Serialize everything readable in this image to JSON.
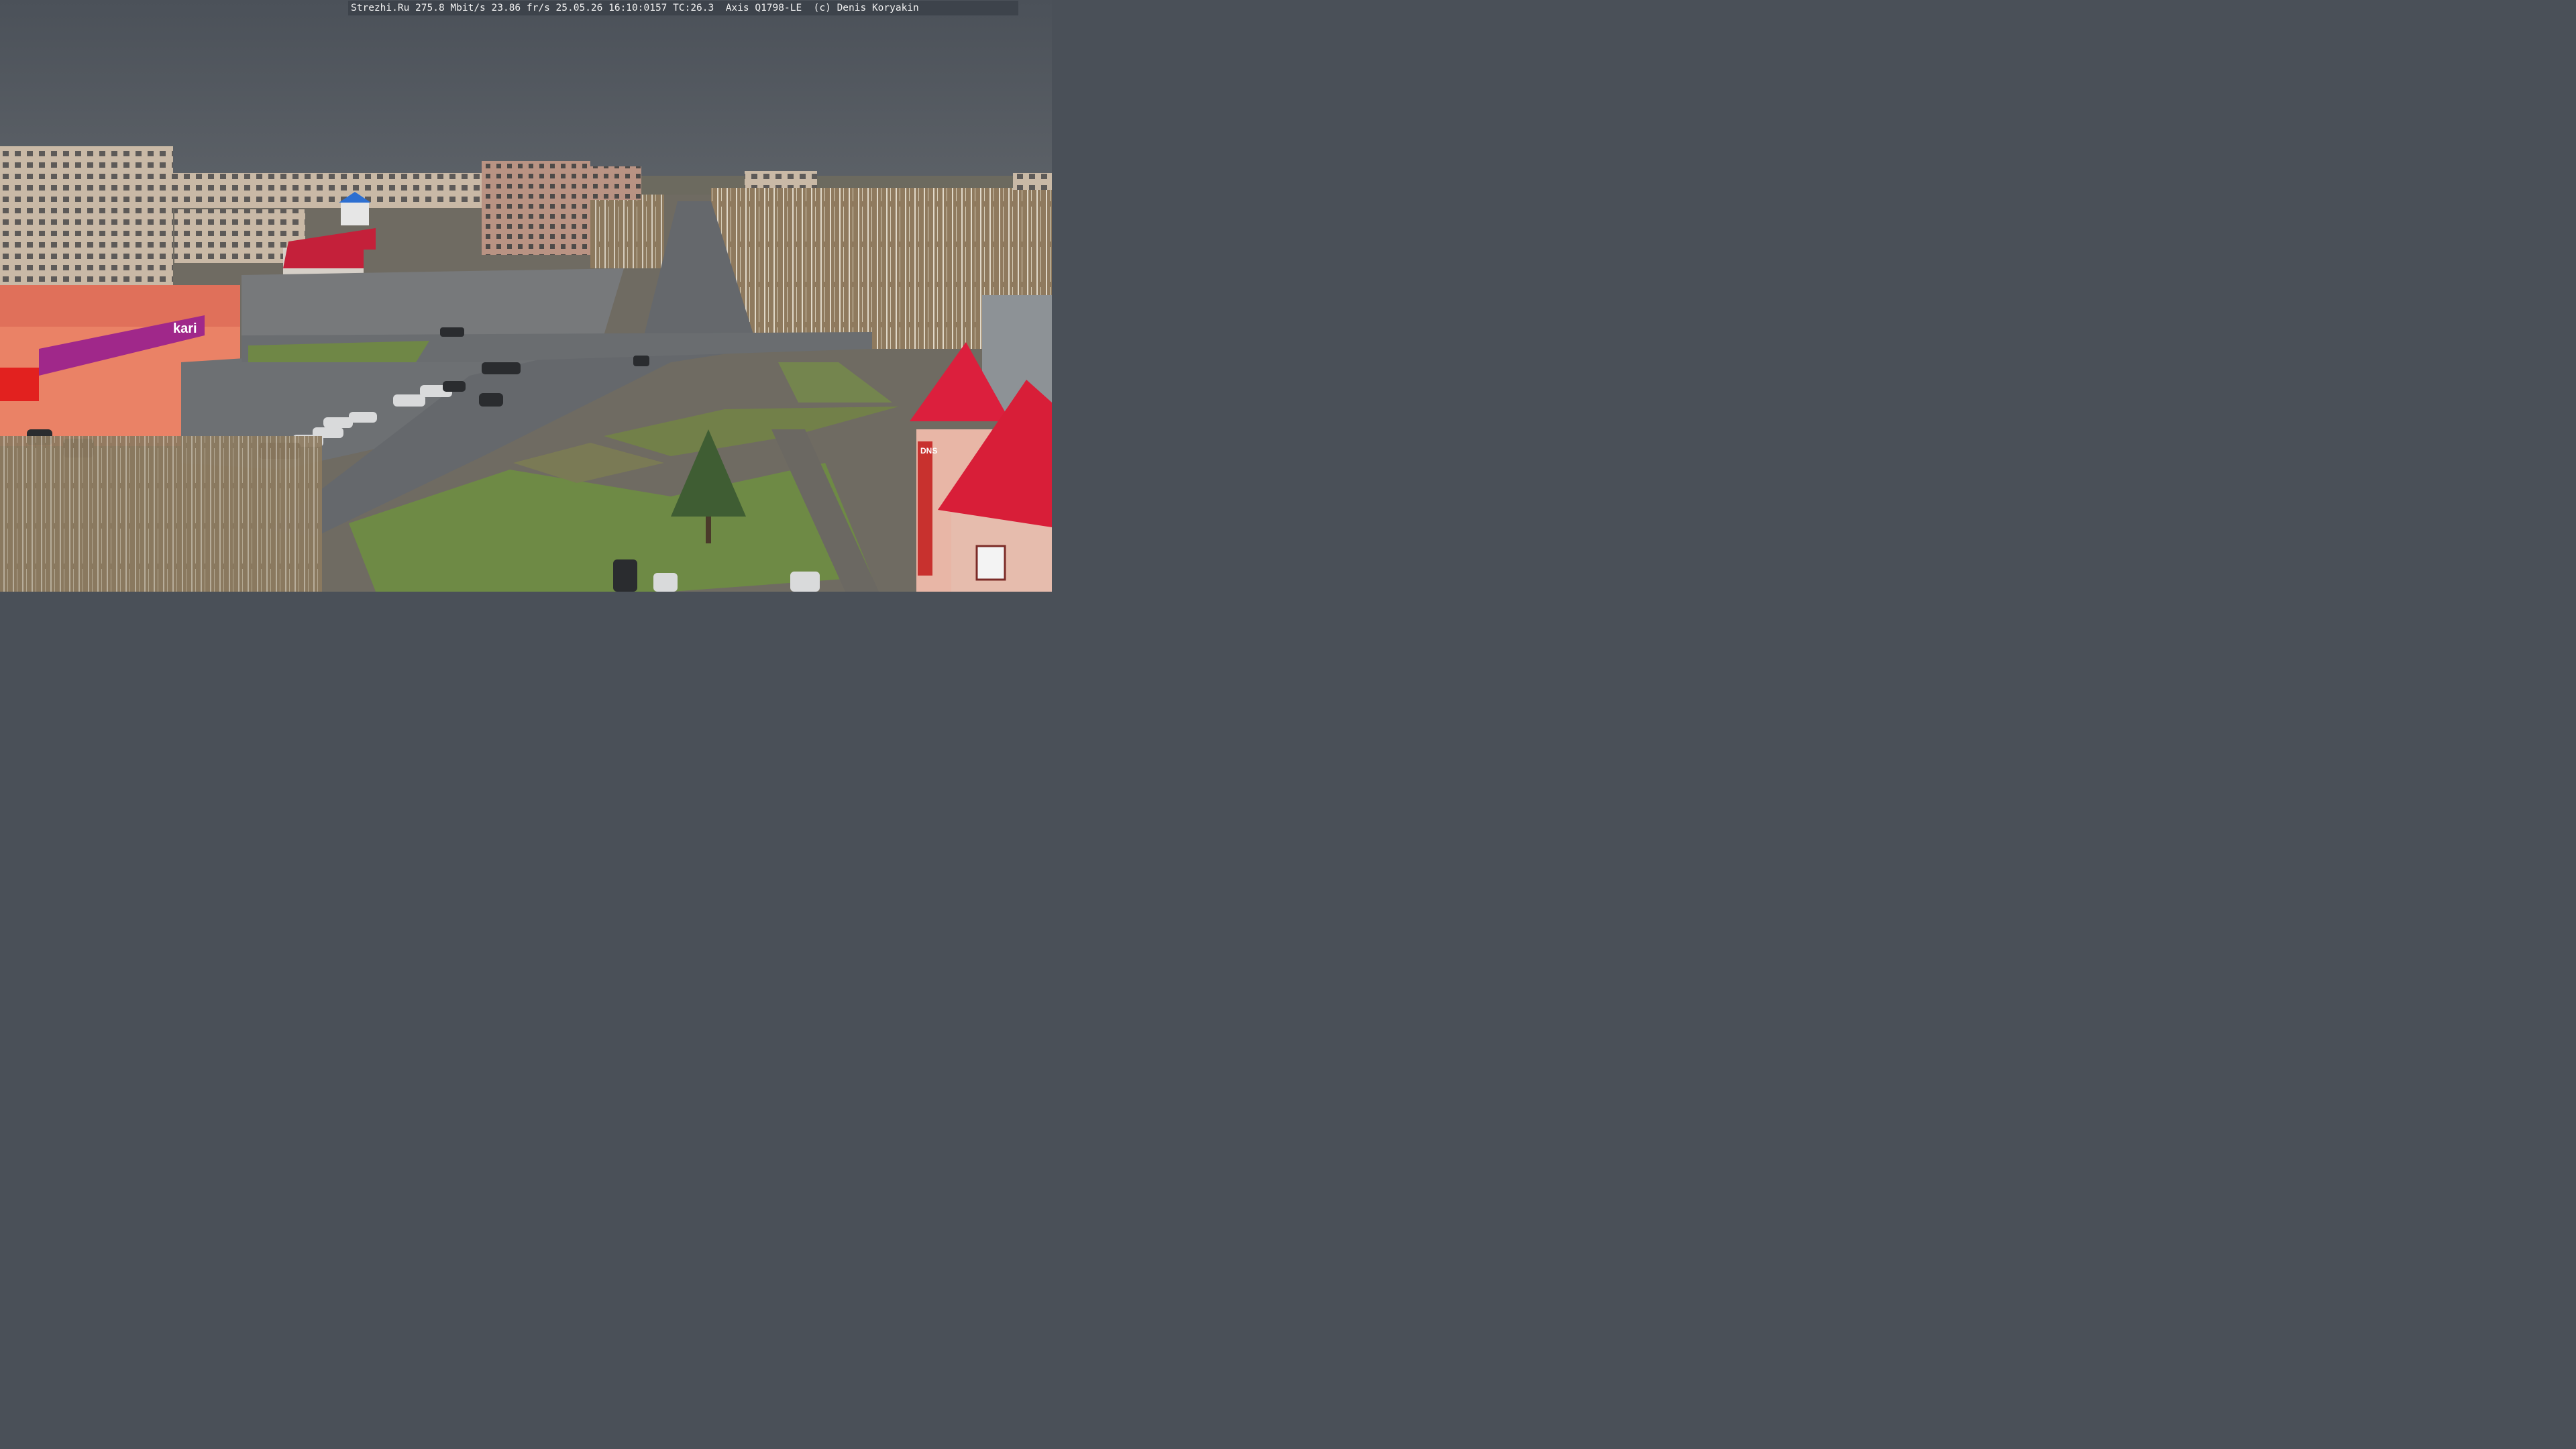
{
  "overlay": {
    "text": "Strezhi.Ru 275.8 Mbit/s 23.86 fr/s 25.05.26 16:10:0157 TC:26.3  Axis Q1798-LE  (c) Denis Koryakin"
  },
  "scene": {
    "store_sign": "kari",
    "building_sign": "DNS"
  },
  "colors": {
    "sky": "#4e545c",
    "road": "#6b6e72",
    "grass": "#6e8a45",
    "red_roof": "#d81e38",
    "kari_banner": "#a0288a",
    "salmon_facade": "#ea8266",
    "panel_building": "#c9b9a6"
  }
}
